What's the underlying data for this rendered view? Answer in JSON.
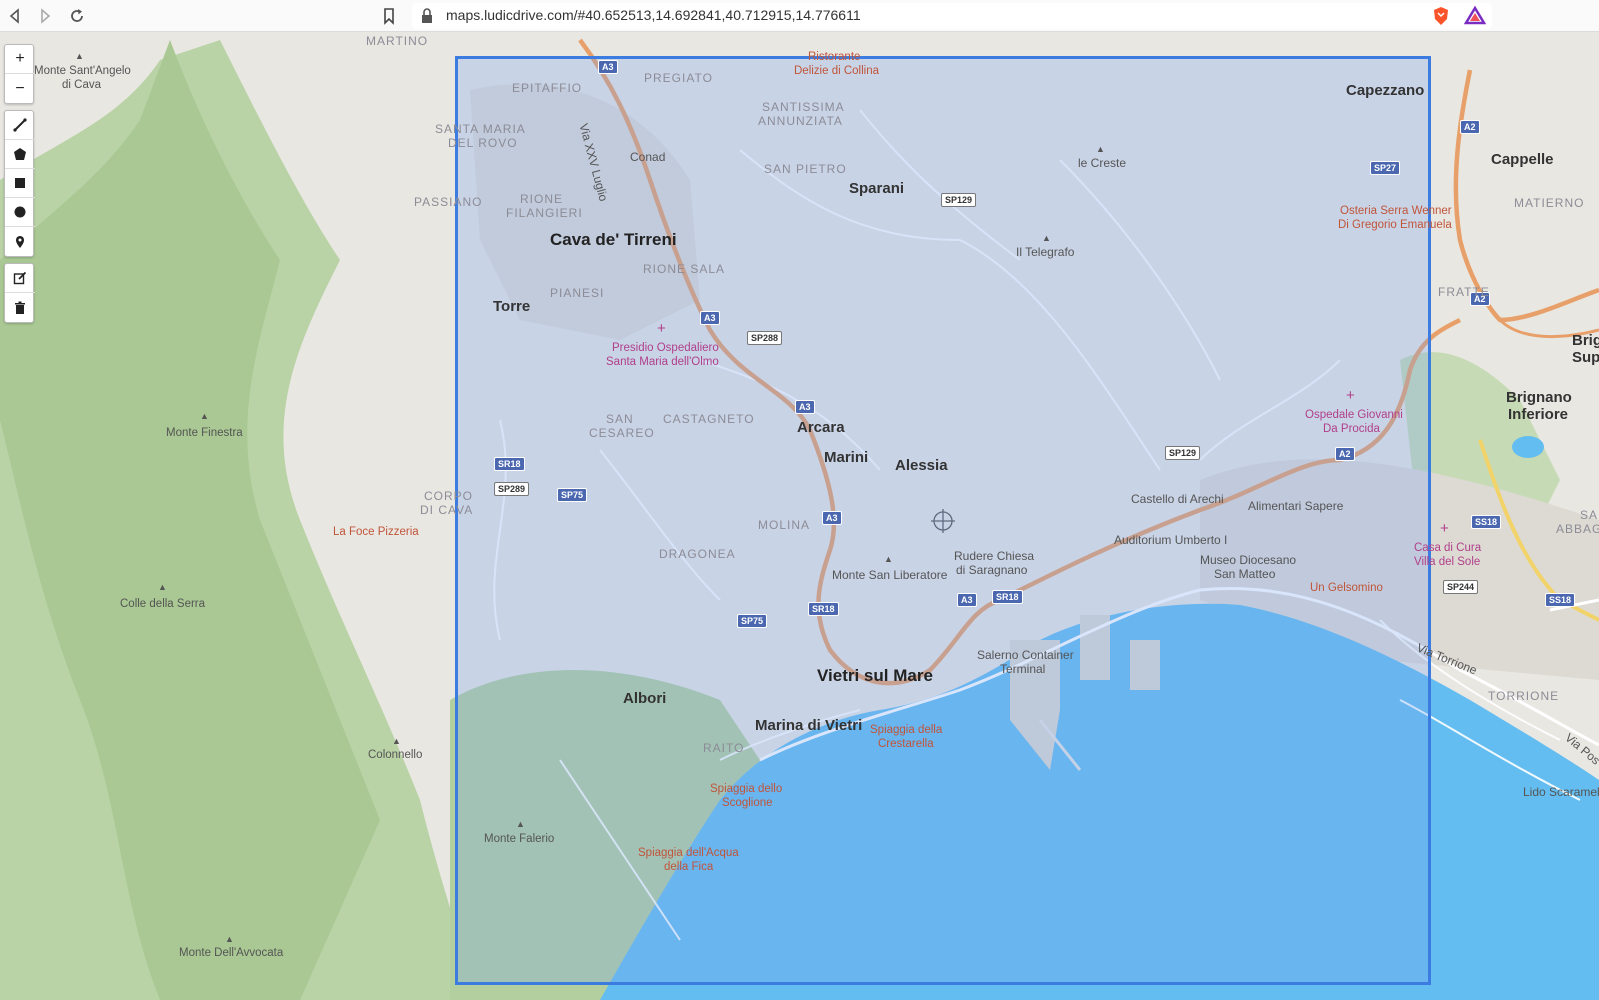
{
  "browser": {
    "url": "maps.ludicdrive.com/#40.652513,14.692841,40.712915,14.776611",
    "icons": [
      "back-icon",
      "forward-icon",
      "reload-icon",
      "bookmark-icon",
      "lock-icon",
      "brave-shield-icon",
      "brave-rewards-icon"
    ]
  },
  "map_tools": {
    "zoom_in": "+",
    "zoom_out": "−",
    "draw_tools": [
      "polyline-icon",
      "polygon-icon",
      "rectangle-icon",
      "circle-icon",
      "marker-icon"
    ],
    "edit_tools": [
      "edit-icon",
      "delete-icon"
    ]
  },
  "labels": {
    "martino": "MARTINO",
    "monte_sant_angelo": "Monte Sant'Angelo",
    "di_cava": "di Cava",
    "epitaffio": "EPITAFFIO",
    "pregiato": "PREGIATO",
    "ristorante": "Ristorante",
    "delizie": "Delizie di Collina",
    "santissima": "SANTISSIMA",
    "annunziata": "ANNUNZIATA",
    "capezzano": "Capezzano",
    "santa_maria": "SANTA MARIA",
    "del_rovo": "DEL ROVO",
    "conad": "Conad",
    "le_creste": "le Creste",
    "cappelle": "Cappelle",
    "san_pietro": "SAN PIETRO",
    "sparani": "Sparani",
    "matierno": "MATIERNO",
    "passiano": "PASSIANO",
    "rione_filangieri_1": "RIONE",
    "rione_filangieri_2": "FILANGIERI",
    "osteria_1": "Osteria Serra Wenner",
    "osteria_2": "Di Gregorio Emanuela",
    "cava": "Cava de' Tirreni",
    "il_telegrafo": "Il Telegrafo",
    "rione_sala": "RIONE SALA",
    "pianesi": "PIANESI",
    "fratte": "FRATTE",
    "torre": "Torre",
    "presidio_1": "Presidio Ospedaliero",
    "presidio_2": "Santa Maria dell'Olmo",
    "brig_1": "Brig",
    "brig_2": "Sup",
    "brignano_1": "Brignano",
    "brignano_2": "Inferiore",
    "ospedale_1": "Ospedale Giovanni",
    "ospedale_2": "Da Procida",
    "monte_finestra": "Monte Finestra",
    "san_cesareo_1": "SAN",
    "san_cesareo_2": "CESAREO",
    "castagneto": "CASTAGNETO",
    "arcara": "Arcara",
    "marini": "Marini",
    "alessia": "Alessia",
    "corpo_1": "CORPO",
    "corpo_2": "DI CAVA",
    "castello": "Castello di Arechi",
    "alimentari": "Alimentari Sapere",
    "la_foce": "La Foce Pizzeria",
    "molina": "MOLINA",
    "auditorium": "Auditorium Umberto I",
    "sa": "SA",
    "abbag": "ABBAG",
    "casa_1": "Casa di Cura",
    "casa_2": "Villa del Sole",
    "dragonea": "DRAGONEA",
    "rudere_1": "Rudere Chiesa",
    "rudere_2": "di Saragnano",
    "museo_1": "Museo Diocesano",
    "museo_2": "San Matteo",
    "monte_san_liberatore": "Monte San Liberatore",
    "un_gelsomino": "Un Gelsomino",
    "colle_serra": "Colle della Serra",
    "salerno_1": "Salerno Container",
    "salerno_2": "Terminal",
    "vietri": "Vietri sul Mare",
    "via_torrione": "Via Torrione",
    "torrione": "TORRIONE",
    "albori": "Albori",
    "marina_vietri": "Marina di Vietri",
    "spiaggia_crest_1": "Spiaggia della",
    "spiaggia_crest_2": "Crestarella",
    "raito": "RAITO",
    "colonnello": "Colonnello",
    "via_pos": "Via Pos",
    "spiaggia_scog_1": "Spiaggia dello",
    "spiaggia_scog_2": "Scoglione",
    "lido": "Lido Scaramell",
    "monte_falerio": "Monte Falerio",
    "spiaggia_acqua_1": "Spiaggia dell'Acqua",
    "spiaggia_acqua_2": "della Fica",
    "monte_avvocata": "Monte Dell'Avvocata",
    "via_xxv": "Via XXV Luglio"
  },
  "shields": {
    "a3_1": "A3",
    "a3_2": "A3",
    "a3_3": "A3",
    "a3_4": "A3",
    "a3_5": "A3",
    "a2_1": "A2",
    "a2_2": "A2",
    "a2_3": "A2",
    "sp27": "SP27",
    "sp129_1": "SP129",
    "sp129_2": "SP129",
    "sp288": "SP288",
    "sr18_1": "SR18",
    "sr18_2": "SR18",
    "sr18_3": "SR18",
    "sp289": "SP289",
    "sp75_1": "SP75",
    "sp75_2": "SP75",
    "ss18_1": "SS18",
    "ss18_2": "SS18",
    "sp244": "SP244"
  },
  "colors": {
    "land": "#e9e7e2",
    "forest": "#b7d2a4",
    "sea": "#63bdf0",
    "highway": "#e8a06a",
    "selection": "#3c7ce0"
  }
}
